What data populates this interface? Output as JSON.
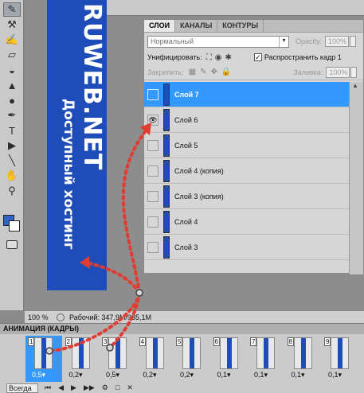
{
  "brand_colors": {
    "banner_blue": "#1e4db9",
    "selection_blue": "#3399ff",
    "arrow_red": "#e03c31"
  },
  "tools": [
    {
      "icon": "brush-icon",
      "glyph": "✎",
      "active": true
    },
    {
      "icon": "stamp-icon",
      "glyph": "⚒"
    },
    {
      "icon": "history-brush-icon",
      "glyph": "✍"
    },
    {
      "icon": "eraser-icon",
      "glyph": "▱"
    },
    {
      "icon": "paint-bucket-icon",
      "glyph": "◒"
    },
    {
      "icon": "blur-icon",
      "glyph": "▲"
    },
    {
      "icon": "dodge-icon",
      "glyph": "●"
    },
    {
      "icon": "pen-icon",
      "glyph": "✒"
    },
    {
      "icon": "type-icon",
      "glyph": "T"
    },
    {
      "icon": "path-select-icon",
      "glyph": "▶"
    },
    {
      "icon": "line-icon",
      "glyph": "╲"
    },
    {
      "icon": "hand-icon",
      "glyph": "✋"
    },
    {
      "icon": "zoom-icon",
      "glyph": "⚲"
    }
  ],
  "banner": {
    "logo": "RUWEB.NET",
    "subtitle": "Доступный хостинг"
  },
  "layers_panel": {
    "tabs": [
      {
        "label": "СЛОИ",
        "active": true
      },
      {
        "label": "КАНАЛЫ"
      },
      {
        "label": "КОНТУРЫ"
      }
    ],
    "blend_mode": "Нормальный",
    "opacity_label": "Opacity:",
    "opacity_value": "100%",
    "unify_label": "Унифицировать:",
    "propagate_label": "Распространить кадр 1",
    "propagate_checked": "✓",
    "lock_label": "Закрепить:",
    "fill_label": "Заливка:",
    "fill_value": "100%",
    "layers": [
      {
        "name": "Слой 7",
        "selected": true,
        "visible": false
      },
      {
        "name": "Слой 6",
        "selected": false,
        "visible": true
      },
      {
        "name": "Слой 5",
        "selected": false,
        "visible": false
      },
      {
        "name": "Слой 4 (копия)",
        "selected": false,
        "visible": false
      },
      {
        "name": "Слой 3 (копия)",
        "selected": false,
        "visible": false
      },
      {
        "name": "Слой 4",
        "selected": false,
        "visible": false
      },
      {
        "name": "Слой 3",
        "selected": false,
        "visible": false
      }
    ]
  },
  "status": {
    "zoom": "100 %",
    "info": "Рабочий: 347,9M/935,1M"
  },
  "animation": {
    "title": "АНИМАЦИЯ (КАДРЫ)",
    "loop": "Всегда",
    "frames": [
      {
        "num": "1",
        "delay": "0,5▾",
        "selected": true
      },
      {
        "num": "2",
        "delay": "0,2▾"
      },
      {
        "num": "3",
        "delay": "0,5▾"
      },
      {
        "num": "4",
        "delay": "0,2▾"
      },
      {
        "num": "5",
        "delay": "0,2▾"
      },
      {
        "num": "6",
        "delay": "0,1▾"
      },
      {
        "num": "7",
        "delay": "0,1▾"
      },
      {
        "num": "8",
        "delay": "0,1▾"
      },
      {
        "num": "9",
        "delay": "0,1▾"
      }
    ],
    "controls": [
      "⏮",
      "◀",
      "▶",
      "▶▶",
      "⚙",
      "□",
      "✕"
    ]
  }
}
